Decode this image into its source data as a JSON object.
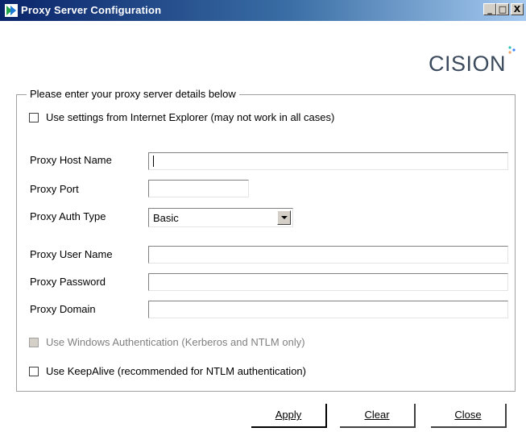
{
  "window": {
    "title": "Proxy Server Configuration",
    "controls": {
      "minimize": "_",
      "maximize": "□",
      "close": "X"
    }
  },
  "logo": {
    "text": "CISION"
  },
  "group": {
    "legend": "Please enter your proxy server details below"
  },
  "ie_settings": {
    "label": "Use settings from Internet Explorer (may not work in all cases)",
    "checked": false
  },
  "fields": {
    "host": {
      "label": "Proxy Host Name",
      "value": ""
    },
    "port": {
      "label": "Proxy Port",
      "value": ""
    },
    "auth_type": {
      "label": "Proxy Auth Type",
      "value": "Basic"
    },
    "user": {
      "label": "Proxy User Name",
      "value": ""
    },
    "password": {
      "label": "Proxy Password",
      "value": ""
    },
    "domain": {
      "label": "Proxy Domain",
      "value": ""
    }
  },
  "windows_auth": {
    "label": "Use Windows Authentication (Kerberos and NTLM only)",
    "enabled": false,
    "checked": false
  },
  "keepalive": {
    "label": "Use KeepAlive (recommended for NTLM authentication)",
    "checked": false
  },
  "buttons": {
    "apply": "Apply",
    "clear": "Clear",
    "close": "Close"
  },
  "colors": {
    "titlebar_start": "#0a246a",
    "titlebar_end": "#a6caf0",
    "logo_text": "#3b4a5c",
    "logo_dots": [
      "#2ec4b6",
      "#3a86ff",
      "#f4a261"
    ]
  }
}
